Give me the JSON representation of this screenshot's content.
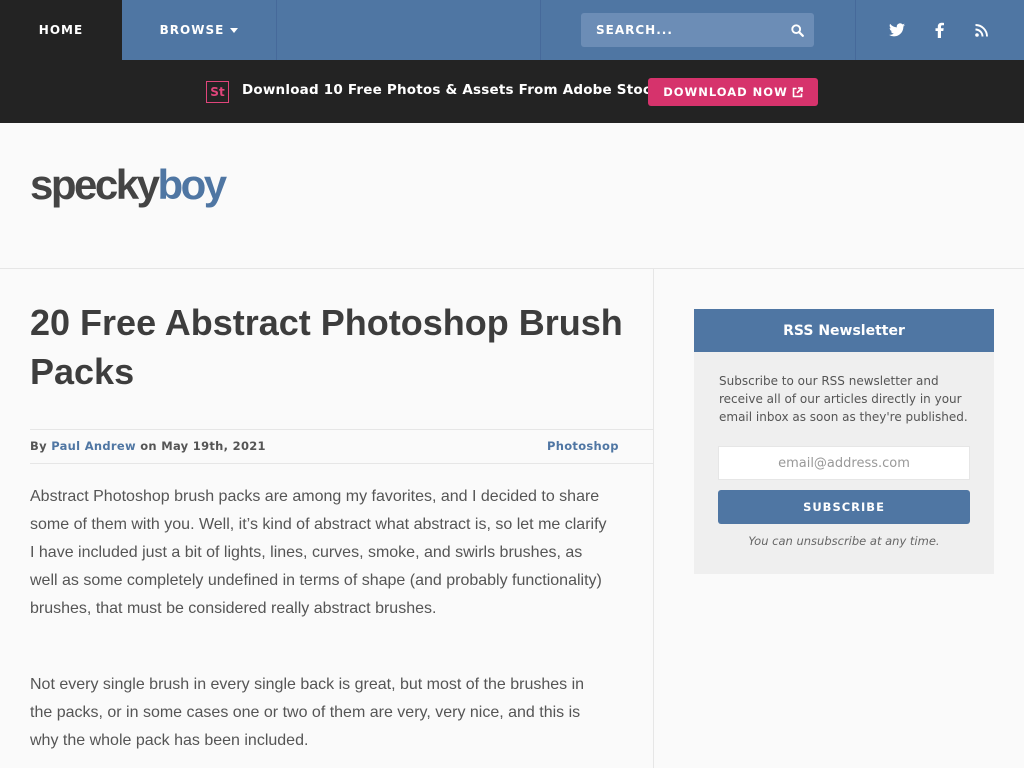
{
  "nav": {
    "home_label": "HOME",
    "browse_label": "BROWSE",
    "search_placeholder": "SEARCH...",
    "social": [
      "twitter-icon",
      "facebook-icon",
      "rss-icon"
    ]
  },
  "promo": {
    "logo_text": "St",
    "text": "Download 10 Free Photos & Assets From Adobe Stock",
    "button_label": "DOWNLOAD NOW"
  },
  "logo": {
    "part1": "specky",
    "part2": "boy"
  },
  "article": {
    "title": "20 Free Abstract Photoshop Brush Packs",
    "meta": {
      "by": "By",
      "author": "Paul Andrew",
      "on": "on May 19th, 2021",
      "category": "Photoshop"
    },
    "paragraphs": [
      "Abstract Photoshop brush packs are among my favorites, and I decided to share some of them with you. Well, it’s kind of abstract what abstract is, so let me clarify I have included just a bit of lights, lines, curves, smoke, and swirls brushes, as well as some completely undefined in terms of shape (and probably functionality) brushes, that must be considered really abstract brushes.",
      "Not every single brush in every single back is great, but most of the brushes in the packs, or in some cases one or two of them are very, very nice, and this is why the whole pack has been included."
    ]
  },
  "sidebar": {
    "title": "RSS Newsletter",
    "description": "Subscribe to our RSS newsletter and receive all of our articles directly in your email inbox as soon as they're published.",
    "email_placeholder": "email@address.com",
    "subscribe_label": "SUBSCRIBE",
    "note": "You can unsubscribe at any time."
  },
  "colors": {
    "nav_blue": "#4f76a3",
    "dark": "#232323",
    "promo_pink": "#d6336c"
  }
}
